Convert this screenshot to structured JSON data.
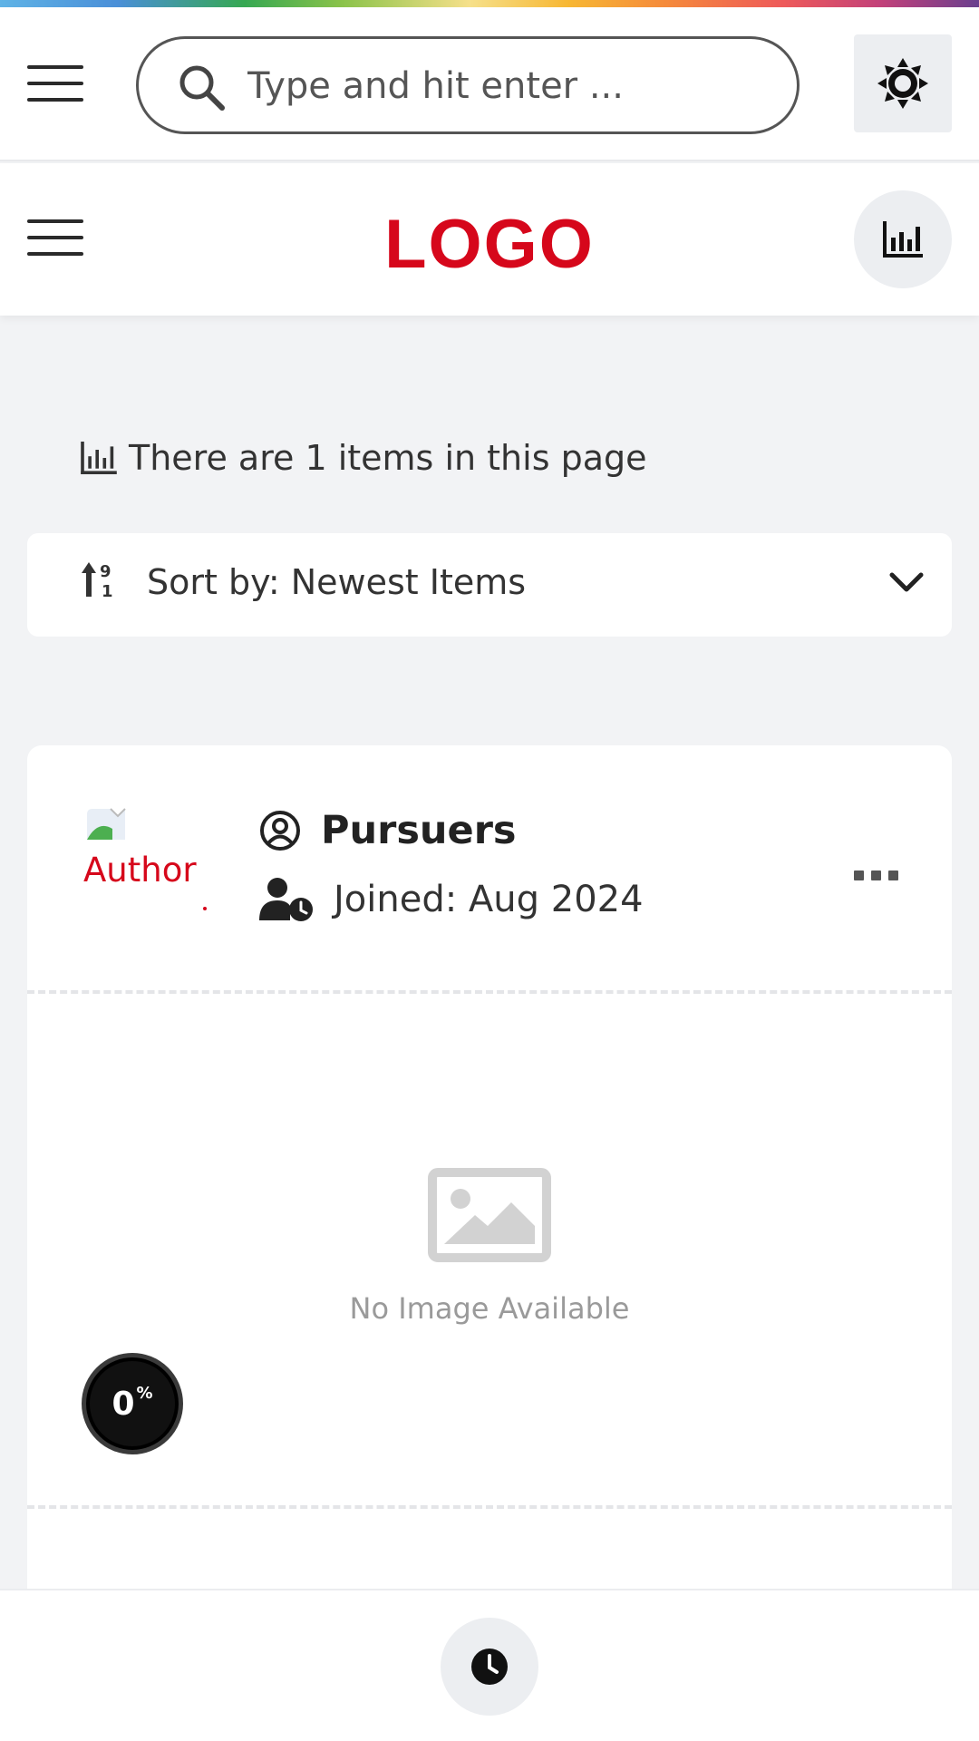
{
  "search": {
    "placeholder": "Type and hit enter ..."
  },
  "header": {
    "logo_text": "LOGO"
  },
  "listing": {
    "count_text": "There are 1 items in this page",
    "sort_label": "Sort by: Newest Items"
  },
  "card": {
    "avatar_alt": "Author",
    "author_name": "Pursuers",
    "joined": "Joined: Aug 2024",
    "no_image_caption": "No Image Available",
    "progress_value": "0",
    "progress_unit": "%",
    "progress_fraction": 0
  },
  "colors": {
    "brand": "#d6071b",
    "background": "#f2f3f5",
    "button_bg": "#eceef1"
  },
  "icons": {
    "top_menu": "hamburger-menu-icon",
    "search": "search-icon",
    "theme": "sun-icon",
    "header_menu": "hamburger-menu-icon",
    "stats": "bar-chart-icon",
    "count": "bar-chart-icon",
    "sort": "sort-numeric-icon",
    "dropdown": "chevron-down-icon",
    "author": "user-circle-icon",
    "joined": "user-clock-icon",
    "more": "ellipsis-icon",
    "placeholder": "image-icon",
    "history": "clock-icon"
  }
}
